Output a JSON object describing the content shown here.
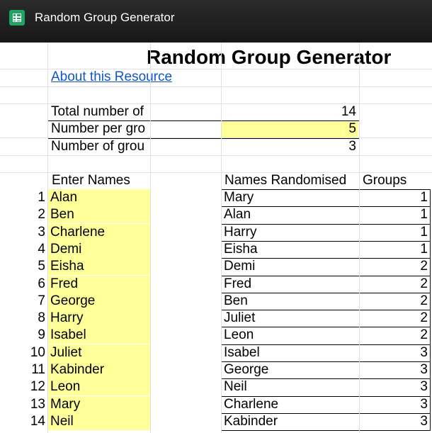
{
  "app": {
    "window_title": "Random Group Generator",
    "icon": "sheets-icon"
  },
  "sheet": {
    "title": "Random Group Generator",
    "link": "About this Resource",
    "summary": [
      {
        "label": "Total number of",
        "value": "14"
      },
      {
        "label": "Number per gro",
        "value": "5"
      },
      {
        "label": "Number of grou",
        "value": "3"
      }
    ],
    "headers": {
      "names": "Enter Names",
      "randomised": "Names Randomised",
      "groups": "Groups"
    },
    "rows": [
      {
        "n": "1",
        "name": "Alan",
        "random": "Mary",
        "group": "1"
      },
      {
        "n": "2",
        "name": "Ben",
        "random": "Alan",
        "group": "1"
      },
      {
        "n": "3",
        "name": "Charlene",
        "random": "Harry",
        "group": "1"
      },
      {
        "n": "4",
        "name": "Demi",
        "random": "Eisha",
        "group": "1"
      },
      {
        "n": "5",
        "name": "Eisha",
        "random": "Demi",
        "group": "2"
      },
      {
        "n": "6",
        "name": "Fred",
        "random": "Fred",
        "group": "2"
      },
      {
        "n": "7",
        "name": "George",
        "random": "Ben",
        "group": "2"
      },
      {
        "n": "8",
        "name": "Harry",
        "random": "Juliet",
        "group": "2"
      },
      {
        "n": "9",
        "name": "Isabel",
        "random": "Leon",
        "group": "2"
      },
      {
        "n": "10",
        "name": "Juliet",
        "random": "Isabel",
        "group": "3"
      },
      {
        "n": "11",
        "name": "Kabinder",
        "random": "George",
        "group": "3"
      },
      {
        "n": "12",
        "name": "Leon",
        "random": "Neil",
        "group": "3"
      },
      {
        "n": "13",
        "name": "Mary",
        "random": "Charlene",
        "group": "3"
      },
      {
        "n": "14",
        "name": "Neil",
        "random": "Kabinder",
        "group": "3"
      }
    ]
  },
  "colors": {
    "input_fill": "#ffff99",
    "link": "#1155cc",
    "titlebar": "#202020"
  }
}
